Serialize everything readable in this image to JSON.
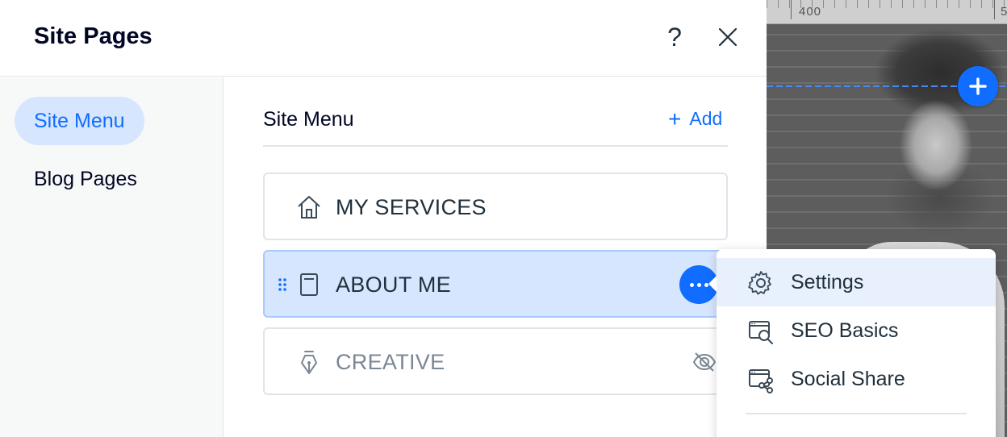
{
  "canvas": {
    "ruler_label": "400",
    "ruler_label_right": "5",
    "add_button_icon": "plus-icon"
  },
  "panel": {
    "title": "Site Pages",
    "help_label": "?",
    "close_icon": "close-icon"
  },
  "left_nav": {
    "items": [
      {
        "label": "Site Menu",
        "active": true
      },
      {
        "label": "Blog Pages",
        "active": false
      }
    ]
  },
  "site_menu": {
    "title": "Site Menu",
    "add_label": "Add",
    "pages": [
      {
        "label": "MY SERVICES",
        "icon": "home-icon",
        "selected": false,
        "hidden": false
      },
      {
        "label": "ABOUT ME",
        "icon": "page-icon",
        "selected": true,
        "hidden": false
      },
      {
        "label": "CREATIVE",
        "icon": "pen-icon",
        "selected": false,
        "hidden": true
      }
    ]
  },
  "context_menu": {
    "items": [
      {
        "label": "Settings",
        "icon": "gear-icon",
        "highlighted": true
      },
      {
        "label": "SEO Basics",
        "icon": "seo-search-icon",
        "highlighted": false
      },
      {
        "label": "Social Share",
        "icon": "social-share-icon",
        "highlighted": false
      }
    ]
  },
  "colors": {
    "accent": "#116dff",
    "selected_bg": "#d6e6fe",
    "text": "#20303c",
    "title": "#000624"
  }
}
